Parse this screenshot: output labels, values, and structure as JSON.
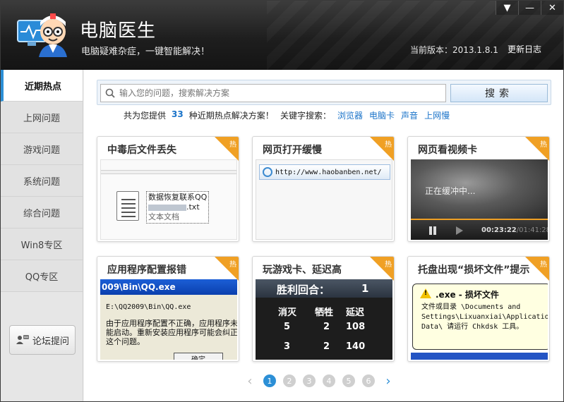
{
  "header": {
    "title": "电脑医生",
    "subtitle": "电脑疑难杂症，一键智能解决！",
    "version": "当前版本：2013.1.8.1",
    "changelog": "更新日志",
    "window_buttons": [
      "▼",
      "—",
      "✕"
    ]
  },
  "sidebar": {
    "items": [
      {
        "label": "近期热点",
        "active": true
      },
      {
        "label": "上网问题"
      },
      {
        "label": "游戏问题"
      },
      {
        "label": "系统问题"
      },
      {
        "label": "综合问题"
      },
      {
        "label": "Win8专区"
      },
      {
        "label": "QQ专区"
      }
    ],
    "forum_button": "论坛提问"
  },
  "search": {
    "placeholder": "输入您的问题，搜索解决方案",
    "button": "搜索"
  },
  "info": {
    "prefix": "共为您提供",
    "count": "33",
    "suffix": "种近期热点解决方案！",
    "keywords_label": "关键字搜索：",
    "keywords": [
      "浏览器",
      "电脑卡",
      "声音",
      "上网慢"
    ]
  },
  "cards": [
    {
      "title": "中毒后文件丢失",
      "hot": "热",
      "thumb": {
        "file_name": "数据恢复联系QQ",
        "ext": ".txt",
        "type": "文本文档"
      }
    },
    {
      "title": "网页打开缓慢",
      "hot": "热",
      "thumb": {
        "url": "http://www.haobanben.net/"
      }
    },
    {
      "title": "网页看视频卡",
      "hot": "热",
      "thumb": {
        "buffering": "正在缓冲中...",
        "time_current": "00:23:22",
        "time_total": "/01:41:28"
      }
    },
    {
      "title": "应用程序配置报错",
      "hot": "热",
      "thumb": {
        "window_title": "009\\Bin\\QQ.exe",
        "path": "E:\\QQ2009\\Bin\\QQ.exe",
        "message": "由于应用程序配置不正确，应用程序未能启动。重新安装应用程序可能会纠正这个问题。",
        "ok": "确定"
      }
    },
    {
      "title": "玩游戏卡、延迟高",
      "hot": "热",
      "thumb": {
        "header_label": "胜利回合：",
        "header_value": "1",
        "columns": [
          "消灭",
          "牺牲",
          "延迟"
        ],
        "rows": [
          [
            "5",
            "2",
            "108"
          ],
          [
            "3",
            "2",
            "140"
          ]
        ]
      }
    },
    {
      "title": "托盘出现“损坏文件”提示",
      "hot": "热",
      "thumb": {
        "title": ".exe - 损坏文件",
        "body": "文件或目录 \\Documents and Settings\\Lixuanxiai\\Application Data\\ 请运行 Chkdsk 工具。"
      }
    }
  ],
  "pagination": {
    "pages": [
      "1",
      "2",
      "3",
      "4",
      "5",
      "6"
    ],
    "current": "1",
    "prev": "‹",
    "next": "›"
  }
}
